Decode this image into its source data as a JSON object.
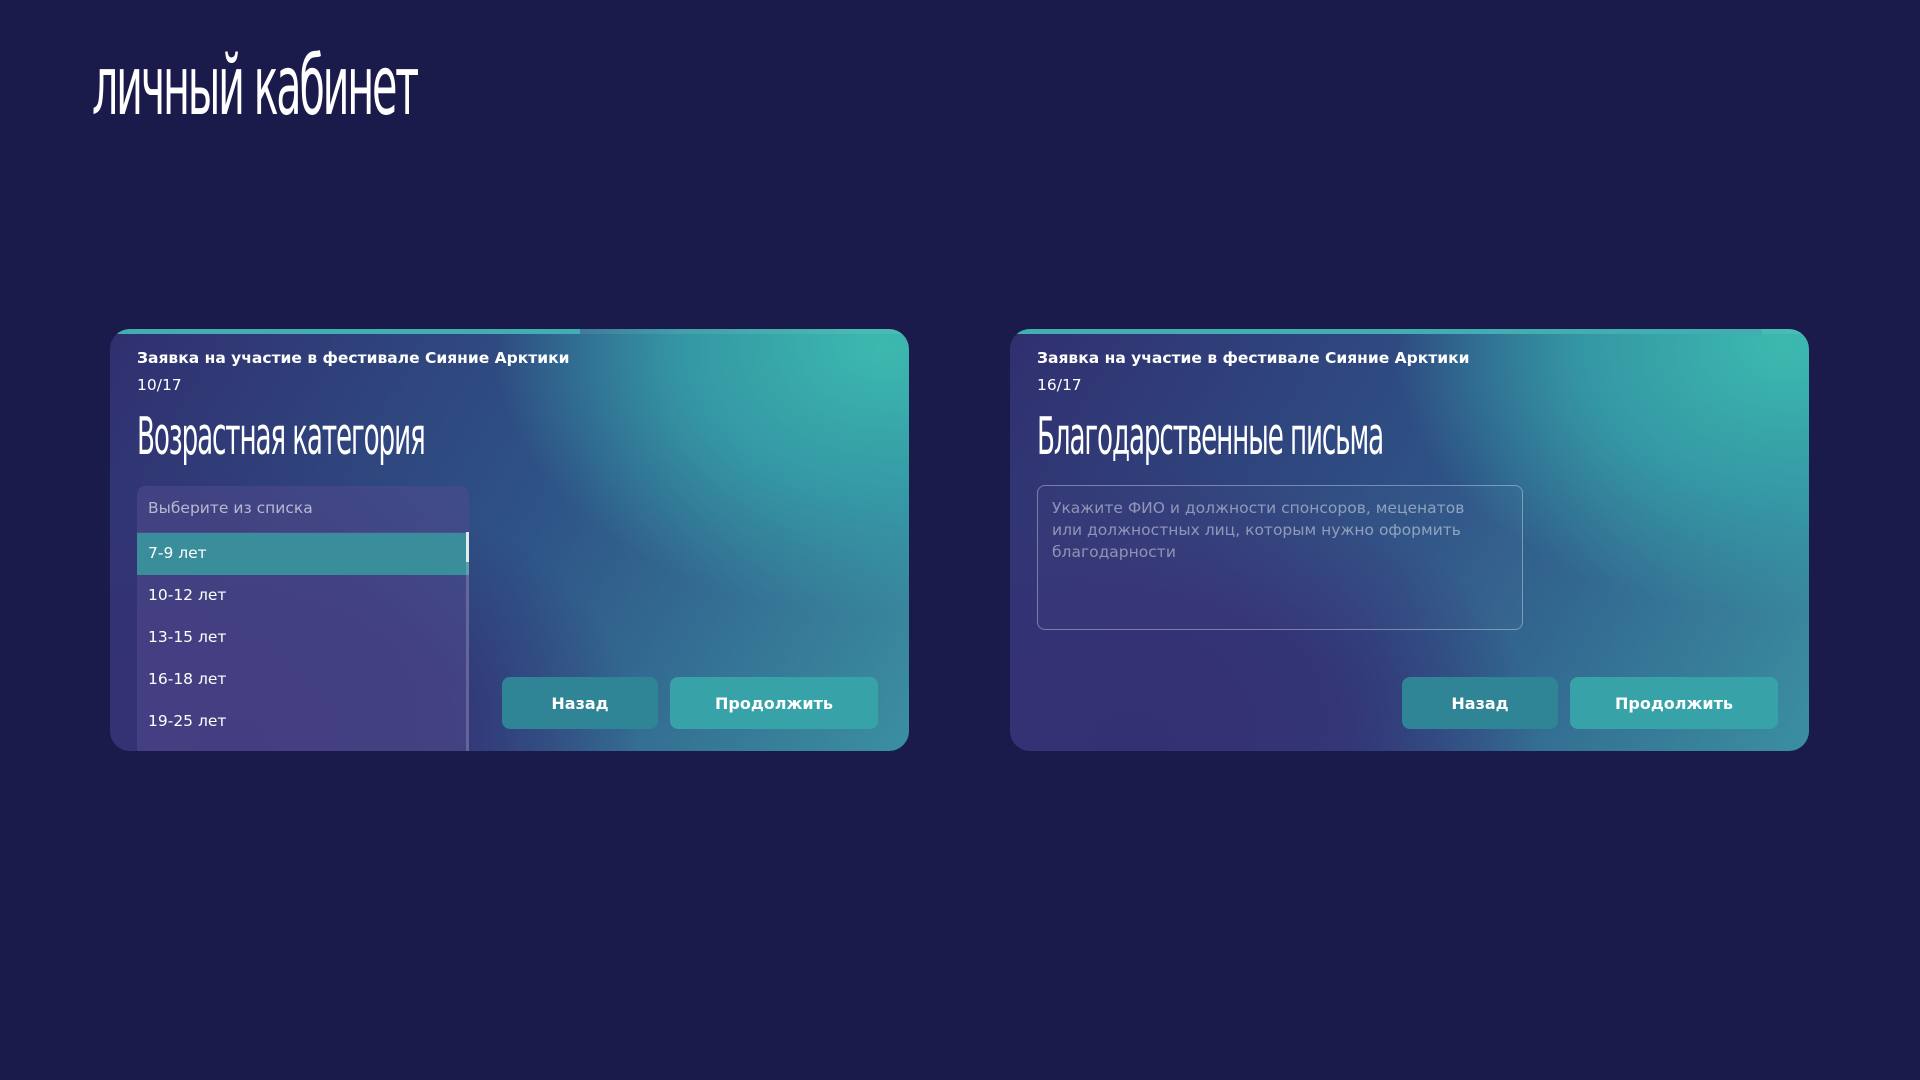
{
  "page": {
    "title": "личный кабинет"
  },
  "forms": [
    {
      "heading": "Заявка на участие в фестивале Сияние Арктики",
      "step": "10/17",
      "progress_fraction": 0.588,
      "question_title": "Возрастная категория",
      "dropdown": {
        "placeholder": "Выберите из списка",
        "options": [
          "7-9 лет",
          "10-12 лет",
          "13-15 лет",
          "16-18 лет",
          "19-25 лет"
        ],
        "highlighted_index": 0
      },
      "buttons": {
        "back_label": "Назад",
        "next_label": "Продолжить"
      }
    },
    {
      "heading": "Заявка на участие в фестивале Сияние Арктики",
      "step": "16/17",
      "progress_fraction": 0.941,
      "question_title": "Благодарственные письма",
      "textarea": {
        "value": "",
        "placeholder": "Укажите ФИО и должности спонсоров, меценатов\nили должностных лиц, которым нужно оформить\nблагодарности"
      },
      "buttons": {
        "back_label": "Назад",
        "next_label": "Продолжить"
      }
    }
  ],
  "colors": {
    "page_background": "#1b1b4b",
    "accent_teal": "#37a3a8",
    "button_back": "#2f8595",
    "selected_option": "#3a8d9a",
    "progress": "#43aeb1"
  }
}
